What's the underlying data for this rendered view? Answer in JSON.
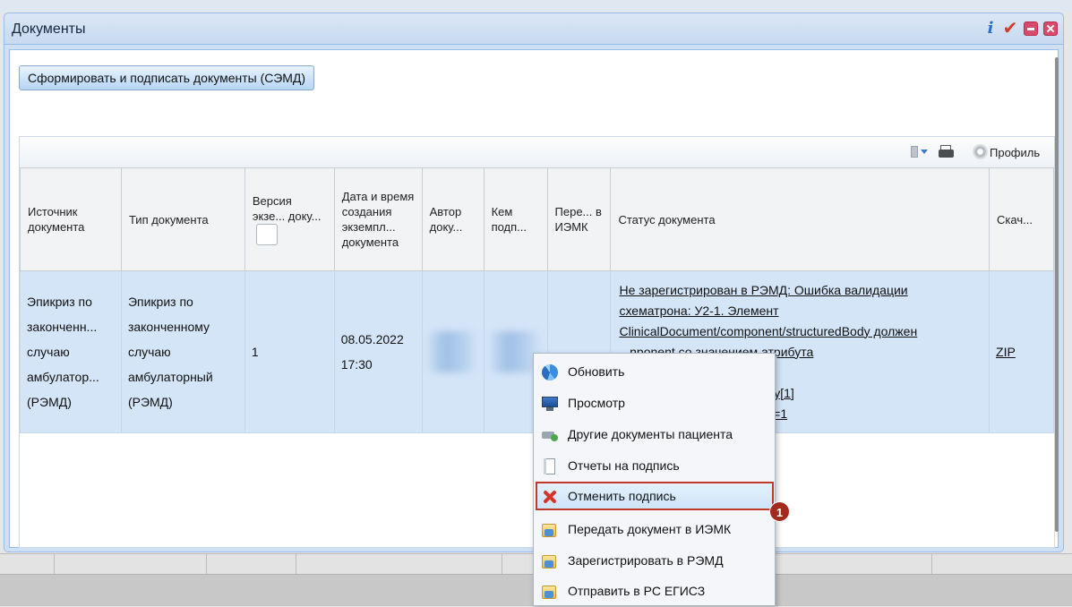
{
  "window": {
    "title": "Документы",
    "tools": {
      "info": "i",
      "confirm": "✔"
    }
  },
  "actions": {
    "sign_button": "Сформировать и подписать документы (СЭМД)"
  },
  "toolbar": {
    "profile_label": "Профиль"
  },
  "table": {
    "columns": [
      "Источник документа",
      "Тип документа",
      "Версия экзе... доку...",
      "Дата и время создания экземпл... документа",
      "Автор доку...",
      "Кем подп...",
      "Пере... в ИЭМК",
      "Статус документа",
      "Скач..."
    ],
    "rows": [
      {
        "source_lines": [
          "Эпикриз по",
          "законченн...",
          "случаю",
          "амбулатор...",
          "(РЭМД)"
        ],
        "type_lines": [
          "Эпикриз по",
          "законченному",
          "случаю",
          "амбулаторный",
          "(РЭМД)"
        ],
        "version": "1",
        "created_date": "08.05.2022",
        "created_time": "17:30",
        "status_lines": [
          "Не зарегистрирован в РЭМД: Ошибка валидации",
          "схематрона: У2-1. Элемент",
          "ClinicalDocument/component/structuredBody должен",
          "...nponent со значением атрибута",
          "...зным 'AMBS'. Путь:",
          "...mponent[1]/structuredBody[1]",
          "...on/code[@code='AMBS'])=1"
        ],
        "download": "ZIP"
      }
    ]
  },
  "context_menu": {
    "items": [
      {
        "label": "Обновить",
        "icon": "refresh-icon"
      },
      {
        "label": "Просмотр",
        "icon": "monitor-icon"
      },
      {
        "label": "Другие документы пациента",
        "icon": "documents-icon"
      },
      {
        "label": "Отчеты на подпись",
        "icon": "report-icon"
      },
      {
        "label": "Отменить подпись",
        "icon": "cancel-icon",
        "highlighted": true
      },
      {
        "label": "Передать документ в ИЭМК",
        "icon": "folder-send-icon"
      },
      {
        "label": "Зарегистрировать в РЭМД",
        "icon": "folder-send-icon"
      },
      {
        "label": "Отправить в РС ЕГИСЗ",
        "icon": "folder-send-icon"
      }
    ]
  },
  "annotation": {
    "badge": "1",
    "color": "#a52a1e"
  }
}
